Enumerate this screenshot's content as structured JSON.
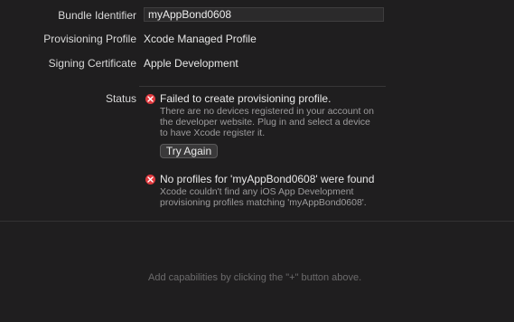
{
  "signing": {
    "bundle_identifier_label": "Bundle Identifier",
    "bundle_identifier_value": "myAppBond0608",
    "provisioning_profile_label": "Provisioning Profile",
    "provisioning_profile_value": "Xcode Managed Profile",
    "signing_certificate_label": "Signing Certificate",
    "signing_certificate_value": "Apple Development"
  },
  "status": {
    "label": "Status",
    "errors": [
      {
        "icon": "error-icon",
        "title": "Failed to create provisioning profile.",
        "detail_lines": [
          "There are no devices registered in your account on",
          "the developer website. Plug in and select a device",
          "to have Xcode register it."
        ],
        "action_label": "Try Again"
      },
      {
        "icon": "error-icon",
        "title": "No profiles for 'myAppBond0608' were found",
        "detail_lines": [
          "Xcode couldn't find any iOS App Development",
          "provisioning profiles matching 'myAppBond0608'."
        ]
      }
    ]
  },
  "capabilities": {
    "placeholder": "Add capabilities by clicking the \"+\" button above."
  },
  "colors": {
    "background": "#1f1e1f",
    "error_red": "#e0393e",
    "secondary_text": "#9d9c9d"
  }
}
